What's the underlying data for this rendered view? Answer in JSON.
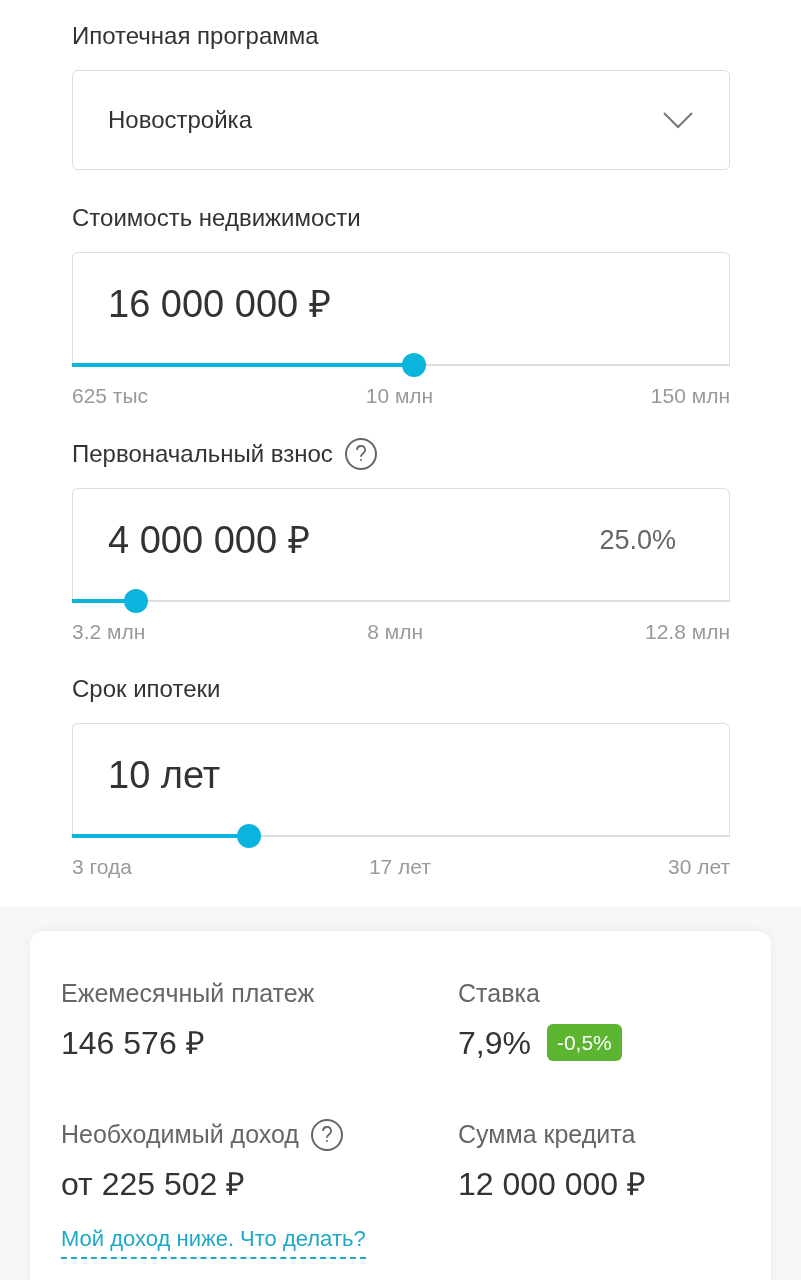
{
  "fields": [
    {
      "kind": "select",
      "label": "Ипотечная программа",
      "help": false,
      "value": "Новостройка"
    },
    {
      "kind": "slider",
      "label": "Стоимость недвижимости",
      "help": false,
      "value": "16 000 000 ₽",
      "level": 0.52,
      "ticks": [
        "625 тыс",
        "10 млн",
        "150 млн"
      ]
    },
    {
      "kind": "slider",
      "label": "Первоначальный взнос",
      "help": true,
      "value": "4 000 000 ₽",
      "extra": "25.0%",
      "level": 0.098,
      "ticks": [
        "3.2 млн",
        "8 млн",
        "12.8 млн"
      ]
    },
    {
      "kind": "slider",
      "label": "Срок ипотеки",
      "help": false,
      "value": "10 лет",
      "level": 0.269,
      "ticks": [
        "3 года",
        "17 лет",
        "30 лет"
      ]
    }
  ],
  "summary": {
    "items": [
      {
        "label": "Ежемесячный платеж",
        "help": false,
        "value": "146 576 ₽"
      },
      {
        "label": "Ставка",
        "help": false,
        "value": "7,9%",
        "badge": {
          "text": "-0,5%",
          "color": "#5cb531"
        }
      },
      {
        "label": "Необходимый доход",
        "help": true,
        "value": "от 225 502 ₽",
        "link": "Мой доход ниже. Что делать?"
      },
      {
        "label": "Сумма кредита",
        "help": false,
        "value": "12 000 000 ₽"
      }
    ]
  }
}
